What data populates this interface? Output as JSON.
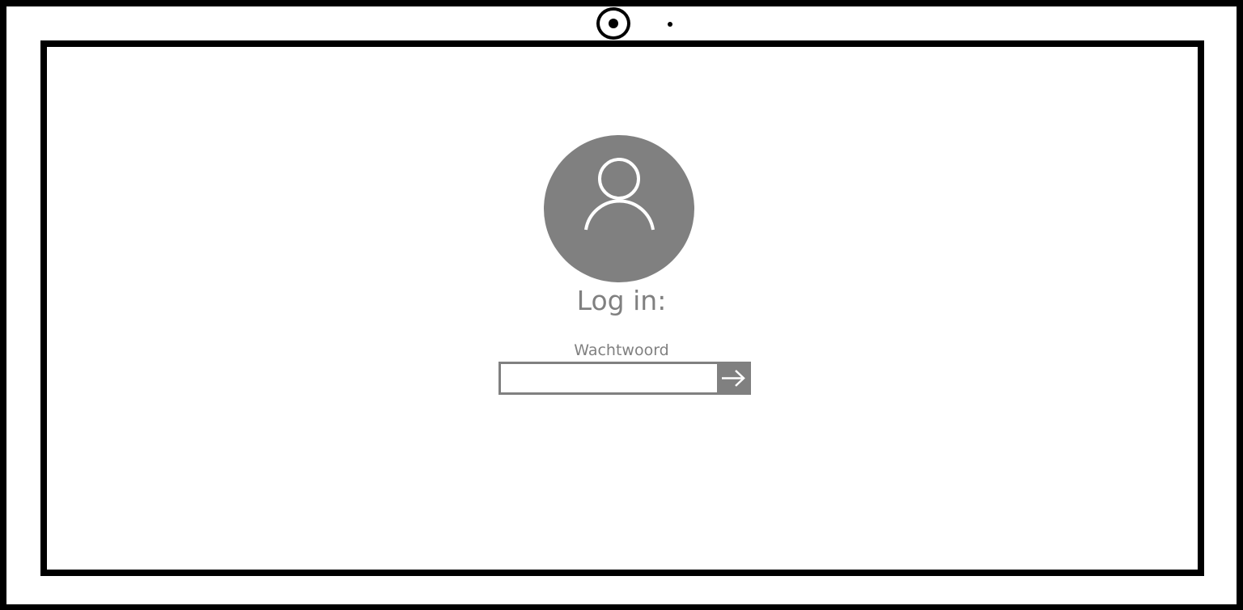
{
  "login": {
    "title": "Log in:",
    "password_label": "Wachtwoord",
    "password_value": "",
    "submit_icon": "arrow-right-icon",
    "avatar_icon": "user-icon"
  },
  "colors": {
    "accent_gray": "#808080",
    "frame": "#000000",
    "background": "#ffffff"
  }
}
